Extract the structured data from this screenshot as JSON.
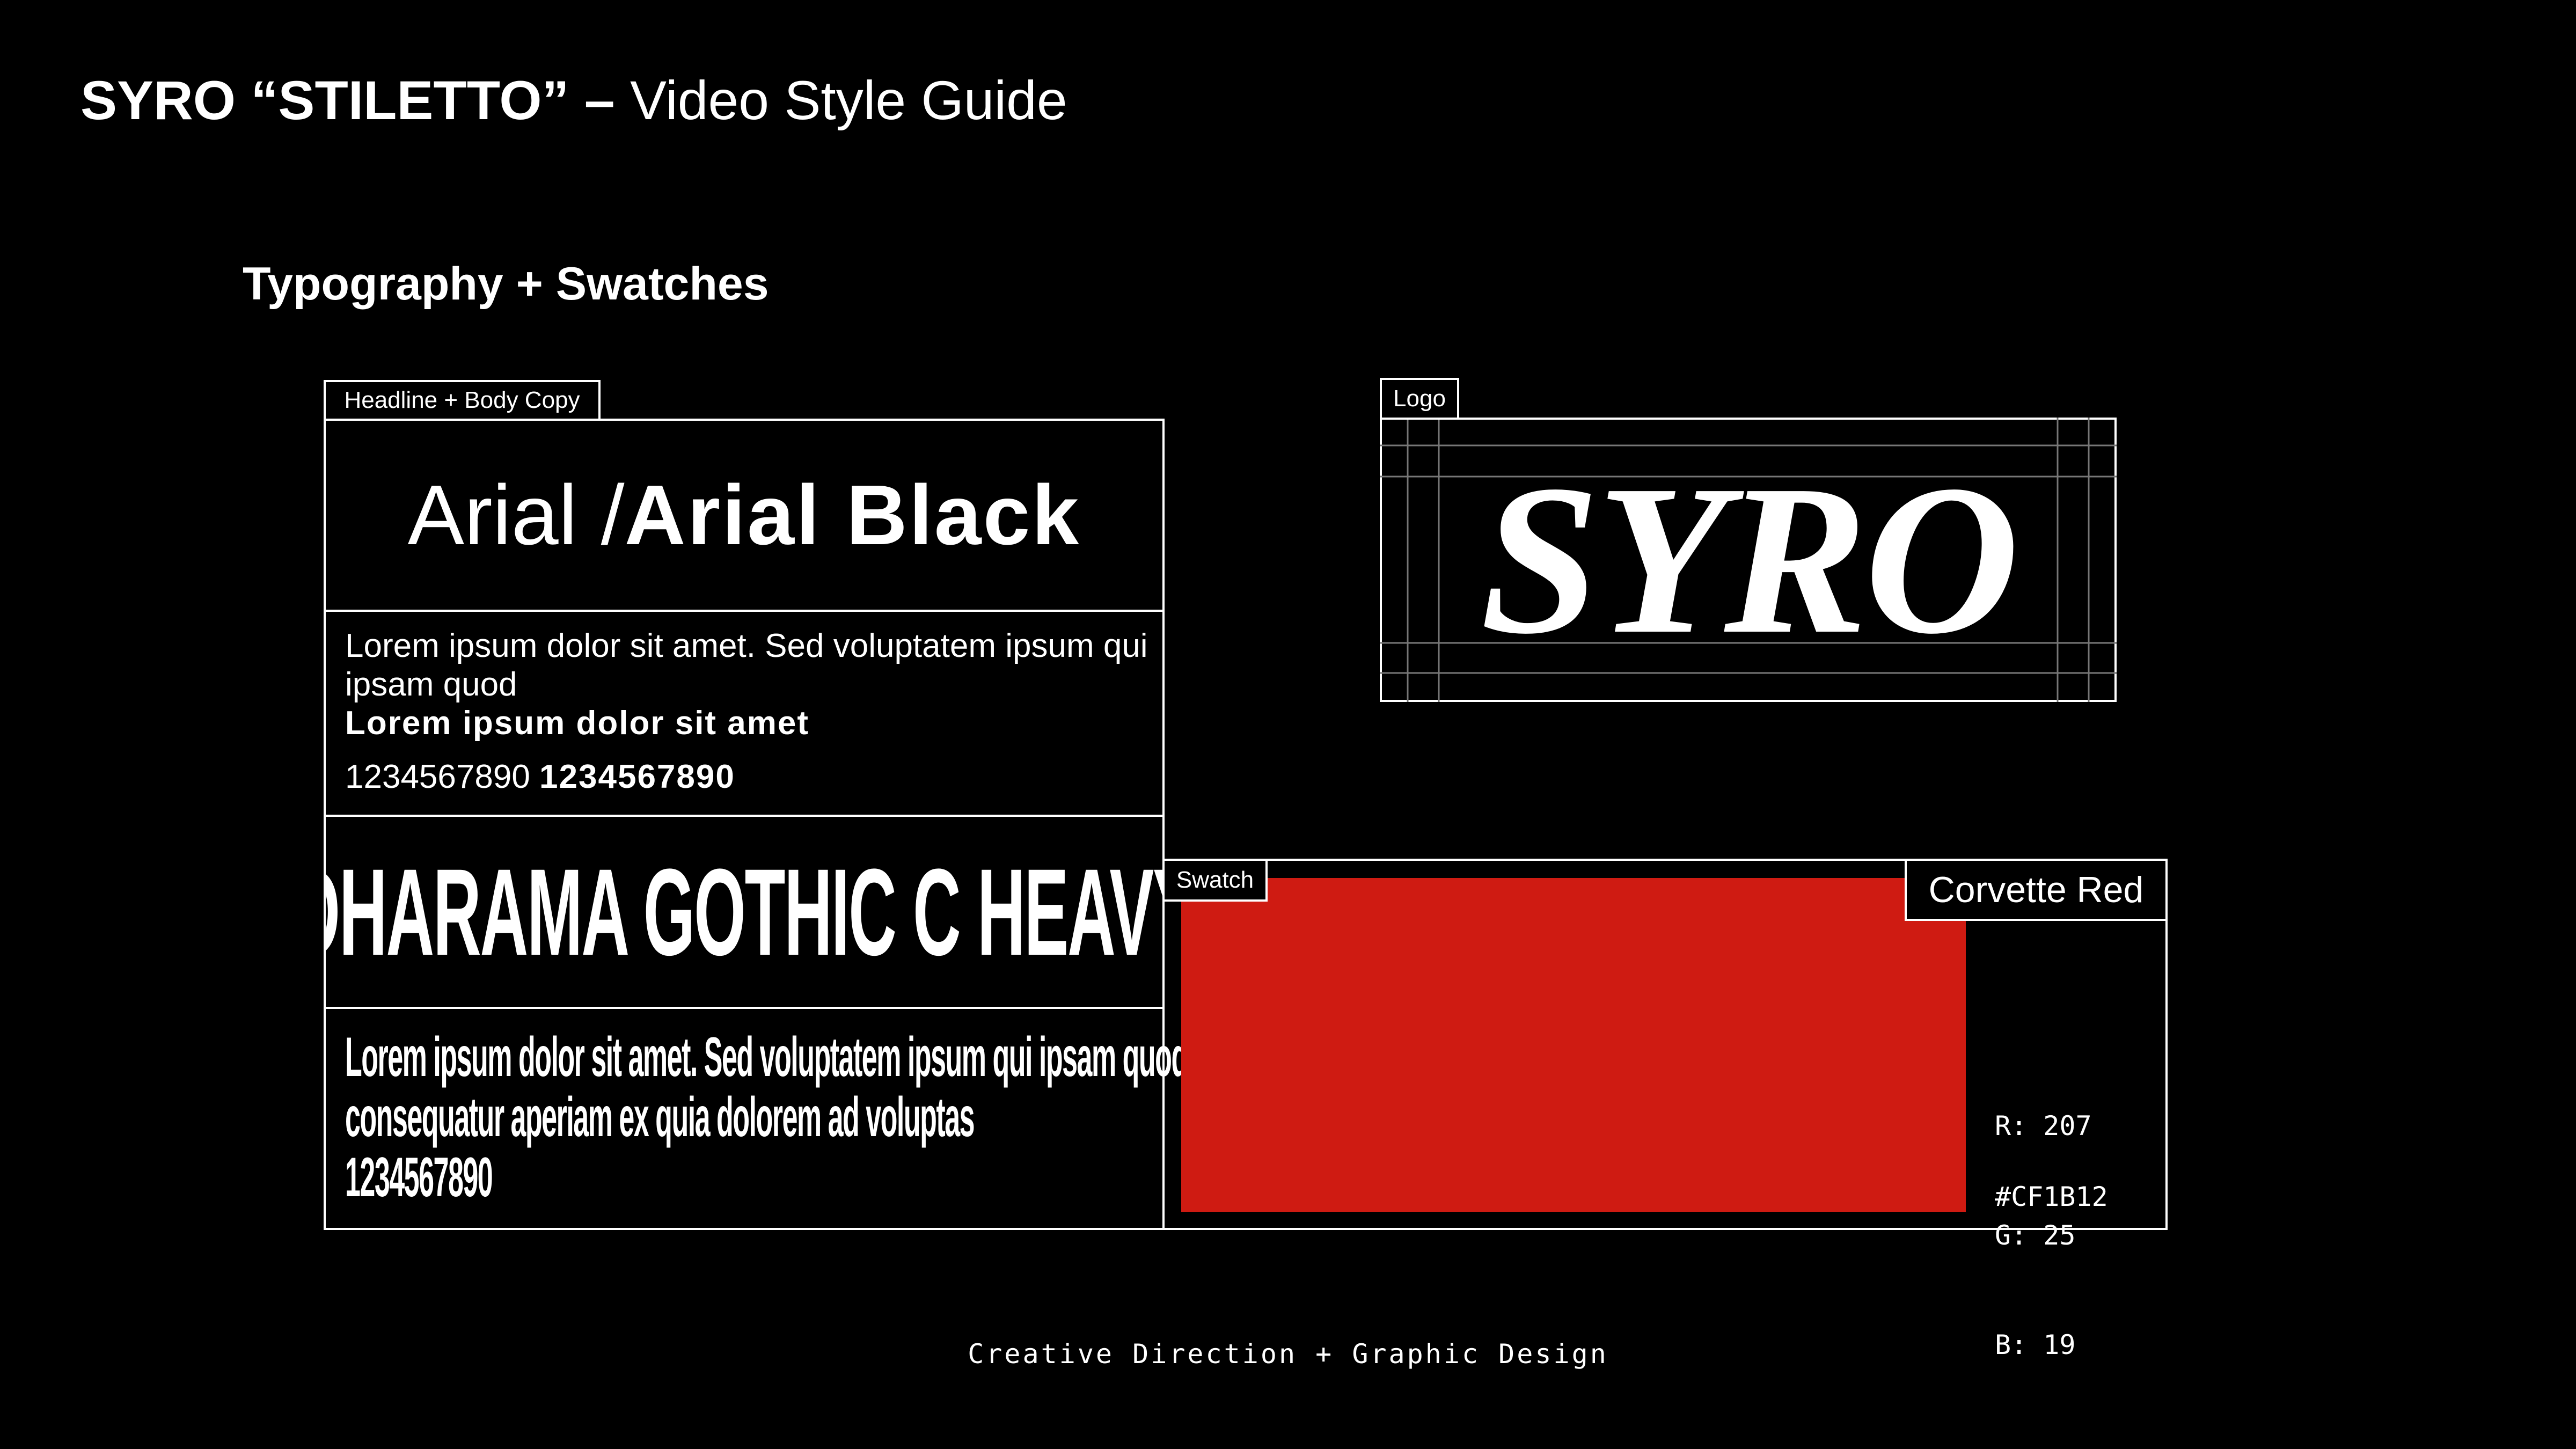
{
  "header": {
    "brand": "SYRO “STILETTO” –",
    "subtitle": " Video Style Guide"
  },
  "section": {
    "title": "Typography + Swatches"
  },
  "typography": {
    "tag": "Headline + Body Copy",
    "headline_regular": "Arial / ",
    "headline_black": "Arial Black",
    "body_regular": "Lorem ipsum dolor sit amet. Sed voluptatem ipsum qui ipsam quod",
    "body_bold": "Lorem ipsum dolor sit amet",
    "numbers_regular": "1234567890 ",
    "numbers_bold": "1234567890",
    "gothic_headline": "DHARAMA GOTHIC C HEAVY",
    "gothic_body_line1": "Lorem ipsum dolor sit amet. Sed voluptatem ipsum qui ipsam quod est",
    "gothic_body_line2": "consequatur aperiam ex quia dolorem ad voluptas",
    "gothic_body_line3": "1234567890"
  },
  "logo": {
    "tag": "Logo",
    "wordmark": "SYRO"
  },
  "swatch": {
    "tag": "Swatch",
    "name": "Corvette Red",
    "color": "#CF1B12",
    "r": "R: 207",
    "g": "G: 25",
    "b": "B: 19",
    "hex": "#CF1B12"
  },
  "footer": {
    "text": "Creative Direction + Graphic Design"
  }
}
